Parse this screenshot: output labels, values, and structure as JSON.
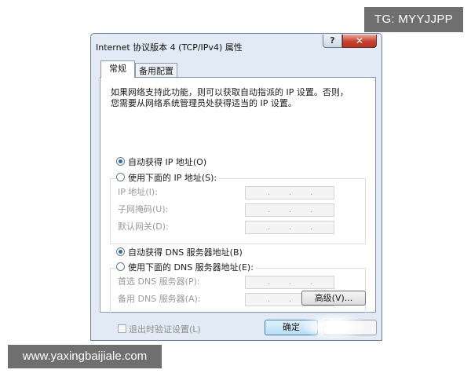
{
  "watermarks": {
    "top_right": "TG: MYYJJPP",
    "bottom_left": "www.yaxingbaijiale.com"
  },
  "window": {
    "title": "Internet 协议版本 4 (TCP/IPv4) 属性",
    "help_icon": "?",
    "close_icon": "✕"
  },
  "tabs": [
    {
      "label": "常规",
      "active": true
    },
    {
      "label": "备用配置",
      "active": false
    }
  ],
  "description": {
    "line1": "如果网络支持此功能，则可以获取自动指派的 IP 设置。否则，",
    "line2": "您需要从网络系统管理员处获得适当的 IP 设置。"
  },
  "ip_section": {
    "auto_option": {
      "label": "自动获得 IP 地址(O)",
      "selected": true
    },
    "manual_option": {
      "label": "使用下面的 IP 地址(S):",
      "selected": false
    },
    "fields": [
      {
        "label": "IP 地址(I):",
        "value": ". . ."
      },
      {
        "label": "子网掩码(U):",
        "value": ". . ."
      },
      {
        "label": "默认网关(D):",
        "value": ". . ."
      }
    ]
  },
  "dns_section": {
    "auto_option": {
      "label": "自动获得 DNS 服务器地址(B)",
      "selected": true
    },
    "manual_option": {
      "label": "使用下面的 DNS 服务器地址(E):",
      "selected": false
    },
    "fields": [
      {
        "label": "首选 DNS 服务器(P):",
        "value": ". . ."
      },
      {
        "label": "备用 DNS 服务器(A):",
        "value": ". . ."
      }
    ]
  },
  "validate_checkbox": {
    "label": "退出时验证设置(L)",
    "checked": false,
    "enabled": false
  },
  "buttons": {
    "advanced": "高级(V)...",
    "ok": "确定",
    "cancel": ""
  },
  "colors": {
    "window_frame": "#e2ebf5",
    "close_button": "#c8412e",
    "selected_radio": "#2b69b8",
    "disabled_text": "#9a9a9a"
  }
}
